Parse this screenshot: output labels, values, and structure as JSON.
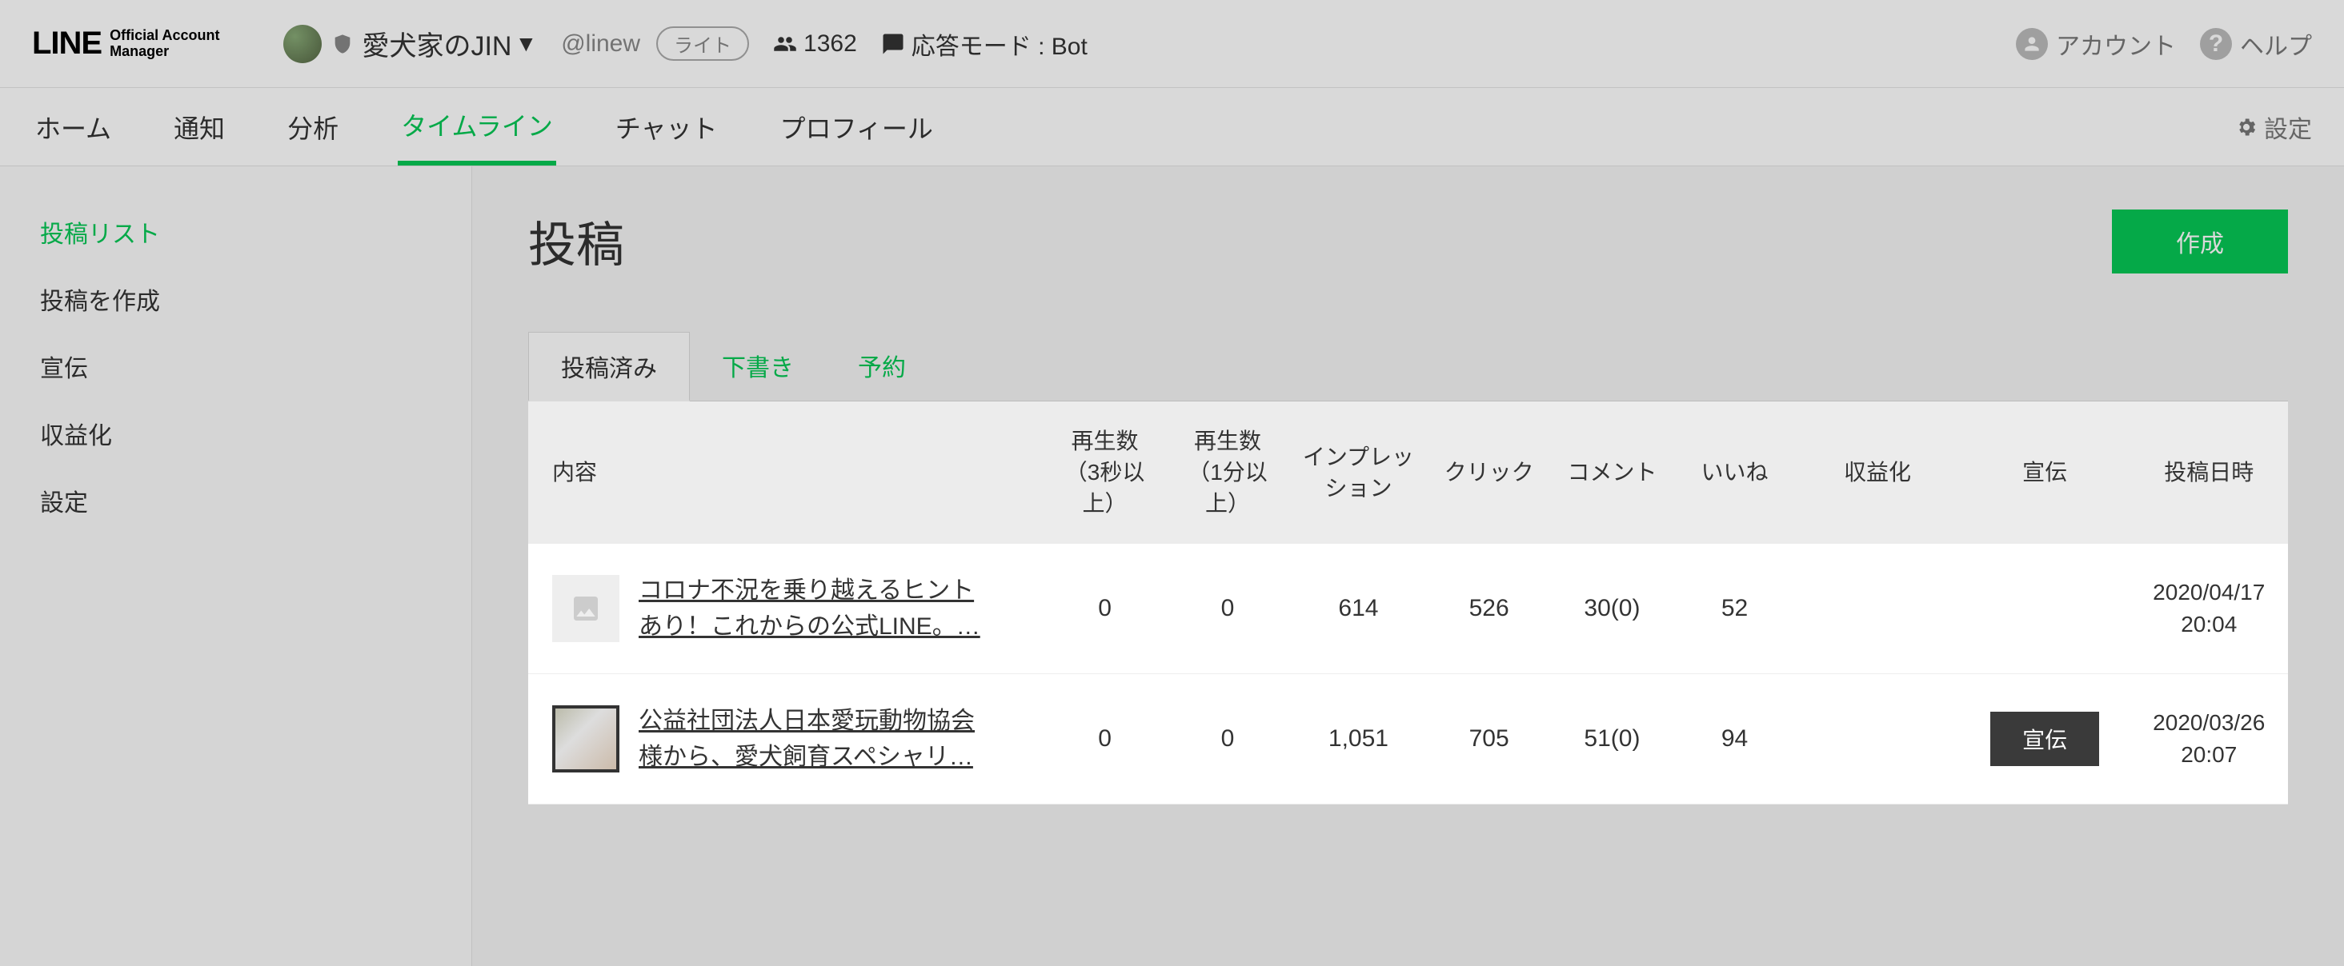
{
  "header": {
    "logo_main": "LINE",
    "logo_sub1": "Official Account",
    "logo_sub2": "Manager",
    "account_name": "愛犬家のJIN",
    "handle": "@linew",
    "badge": "ライト",
    "followers": "1362",
    "response_mode_label": "応答モード : Bot",
    "account_menu": "アカウント",
    "help": "ヘルプ"
  },
  "nav": {
    "items": [
      "ホーム",
      "通知",
      "分析",
      "タイムライン",
      "チャット",
      "プロフィール"
    ],
    "active_index": 3,
    "settings": "設定"
  },
  "sidebar": {
    "items": [
      "投稿リスト",
      "投稿を作成",
      "宣伝",
      "収益化",
      "設定"
    ],
    "active_index": 0
  },
  "page": {
    "title": "投稿",
    "create_button": "作成"
  },
  "tabs": {
    "items": [
      "投稿済み",
      "下書き",
      "予約"
    ],
    "active_index": 0
  },
  "table": {
    "headers": {
      "content": "内容",
      "plays3s": "再生数（3秒以上）",
      "plays1m": "再生数（1分以上）",
      "impressions": "インプレッション",
      "clicks": "クリック",
      "comments": "コメント",
      "likes": "いいね",
      "monetize": "収益化",
      "promote": "宣伝",
      "posted_at": "投稿日時"
    },
    "rows": [
      {
        "title": "コロナ不況を乗り越えるヒントあり！これからの公式LINE。…",
        "thumb_type": "placeholder",
        "plays3s": "0",
        "plays1m": "0",
        "impressions": "614",
        "clicks": "526",
        "comments": "30(0)",
        "likes": "52",
        "monetize": "",
        "promote": "",
        "posted_at": "2020/04/17 20:04"
      },
      {
        "title": "公益社団法人日本愛玩動物協会様から、愛犬飼育スペシャリ…",
        "thumb_type": "photo",
        "plays3s": "0",
        "plays1m": "0",
        "impressions": "1,051",
        "clicks": "705",
        "comments": "51(0)",
        "likes": "94",
        "monetize": "",
        "promote": "宣伝",
        "posted_at": "2020/03/26 20:07"
      }
    ]
  }
}
